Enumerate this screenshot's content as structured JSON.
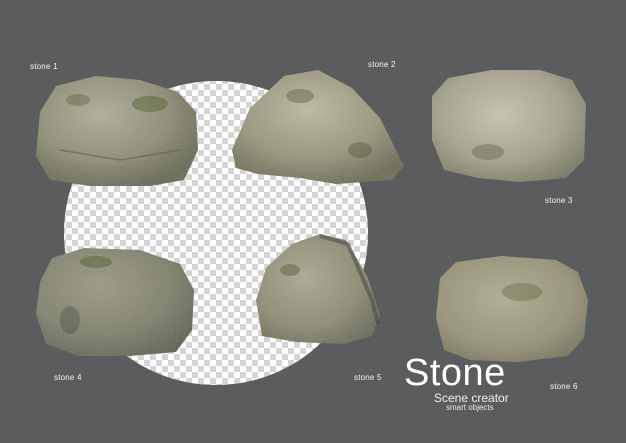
{
  "stones": [
    {
      "label": "stone 1"
    },
    {
      "label": "stone 2"
    },
    {
      "label": "stone 3"
    },
    {
      "label": "stone 4"
    },
    {
      "label": "stone 5"
    },
    {
      "label": "stone 6"
    }
  ],
  "brand": {
    "title": "Stone",
    "subtitle": "Scene creator",
    "tagline": "smart objects"
  },
  "colors": {
    "background": "#5b5c5e",
    "checker_light": "#ffffff",
    "checker_dark": "#d4d4d4",
    "stone_base": "#8f8c7a",
    "moss": "#5f6a3e"
  }
}
